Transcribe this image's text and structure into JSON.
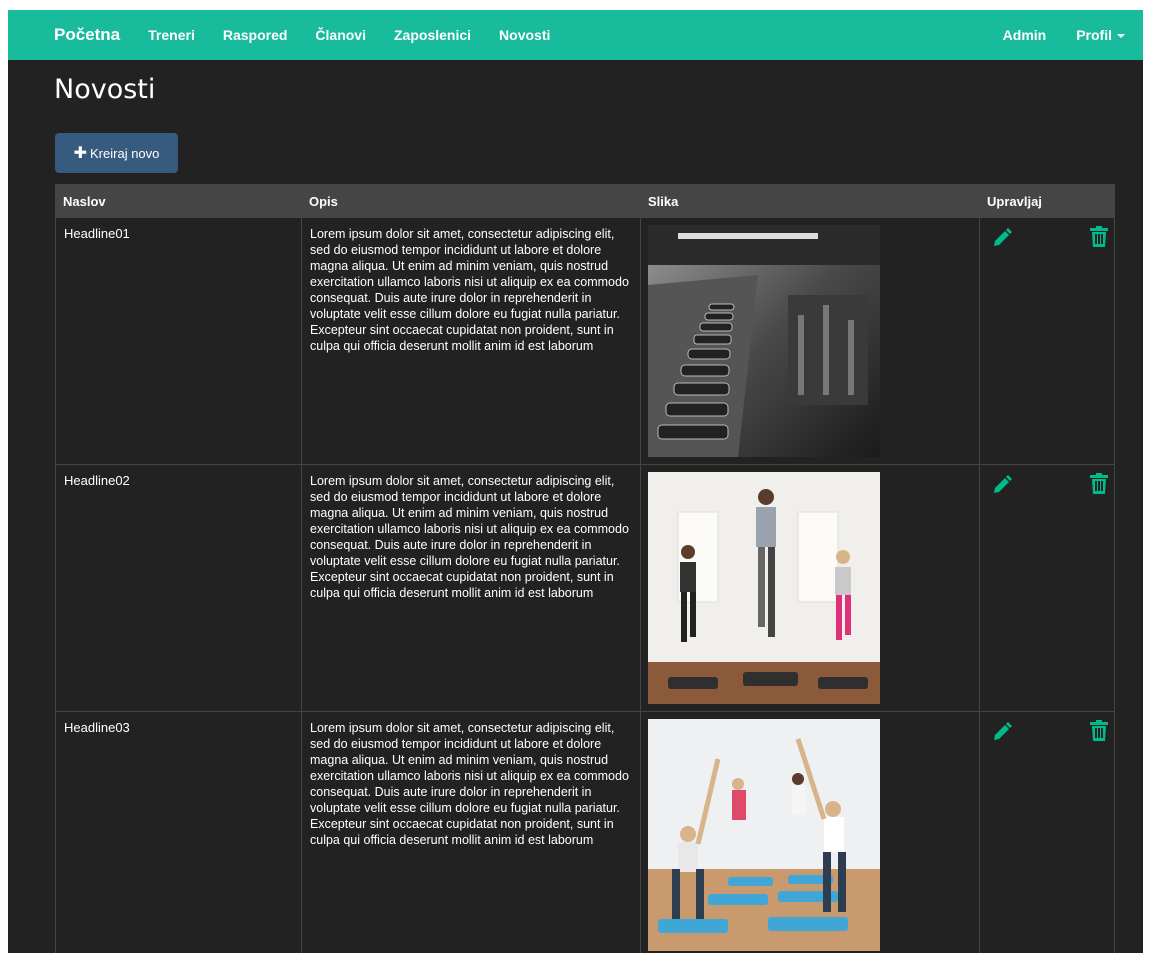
{
  "nav": {
    "brand": "Početna",
    "links": [
      "Treneri",
      "Raspored",
      "Članovi",
      "Zaposlenici",
      "Novosti"
    ],
    "admin": "Admin",
    "profile": "Profil"
  },
  "page": {
    "title": "Novosti",
    "create_label": "Kreiraj novo"
  },
  "table": {
    "headers": [
      "Naslov",
      "Opis",
      "Slika",
      "Upravljaj"
    ],
    "rows": [
      {
        "title": "Headline01",
        "description": "Lorem ipsum dolor sit amet, consectetur adipiscing elit, sed do eiusmod tempor incididunt ut labore et dolore magna aliqua. Ut enim ad minim veniam, quis nostrud exercitation ullamco laboris nisi ut aliquip ex ea commodo consequat. Duis aute irure dolor in reprehenderit in voluptate velit esse cillum dolore eu fugiat nulla pariatur. Excepteur sint occaecat cupidatat non proident, sunt in culpa qui officia deserunt mollit anim id est laborum"
      },
      {
        "title": "Headline02",
        "description": "Lorem ipsum dolor sit amet, consectetur adipiscing elit, sed do eiusmod tempor incididunt ut labore et dolore magna aliqua. Ut enim ad minim veniam, quis nostrud exercitation ullamco laboris nisi ut aliquip ex ea commodo consequat. Duis aute irure dolor in reprehenderit in voluptate velit esse cillum dolore eu fugiat nulla pariatur. Excepteur sint occaecat cupidatat non proident, sunt in culpa qui officia deserunt mollit anim id est laborum"
      },
      {
        "title": "Headline03",
        "description": "Lorem ipsum dolor sit amet, consectetur adipiscing elit, sed do eiusmod tempor incididunt ut labore et dolore magna aliqua. Ut enim ad minim veniam, quis nostrud exercitation ullamco laboris nisi ut aliquip ex ea commodo consequat. Duis aute irure dolor in reprehenderit in voluptate velit esse cillum dolore eu fugiat nulla pariatur. Excepteur sint occaecat cupidatat non proident, sunt in culpa qui officia deserunt mollit anim id est laborum"
      }
    ]
  },
  "icons": {
    "create": "plus-icon",
    "edit": "pencil-icon",
    "delete": "trash-icon",
    "profile_dropdown": "caret-down-icon"
  },
  "colors": {
    "navbar": "#18bc9c",
    "background": "#222222",
    "table_header": "#464545",
    "primary_button": "#375a7f",
    "action_icon": "#00bc8c"
  }
}
